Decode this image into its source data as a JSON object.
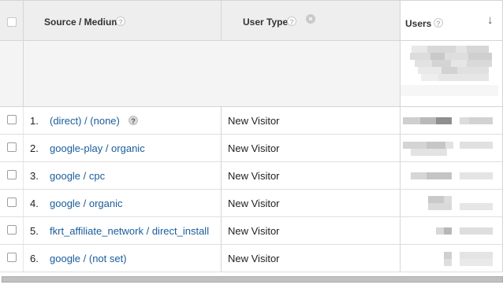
{
  "header": {
    "source_medium": "Source / Medium",
    "user_type": "User Type",
    "users": "Users",
    "help_glyph": "?",
    "remove_glyph": "×",
    "sort_glyph": "↓"
  },
  "rows": [
    {
      "num": "1.",
      "source": "(direct) / (none)",
      "user_type": "New Visitor",
      "has_help": true
    },
    {
      "num": "2.",
      "source": "google-play / organic",
      "user_type": "New Visitor"
    },
    {
      "num": "3.",
      "source": "google / cpc",
      "user_type": "New Visitor"
    },
    {
      "num": "4.",
      "source": "google / organic",
      "user_type": "New Visitor"
    },
    {
      "num": "5.",
      "source": "fkrt_affiliate_network / direct_install",
      "user_type": "New Visitor"
    },
    {
      "num": "6.",
      "source": "google / (not set)",
      "user_type": "New Visitor"
    }
  ],
  "colors": {
    "link": "#1a5c9c",
    "header_bg": "#eeeeee",
    "summary_bg": "#f4f4f4"
  }
}
